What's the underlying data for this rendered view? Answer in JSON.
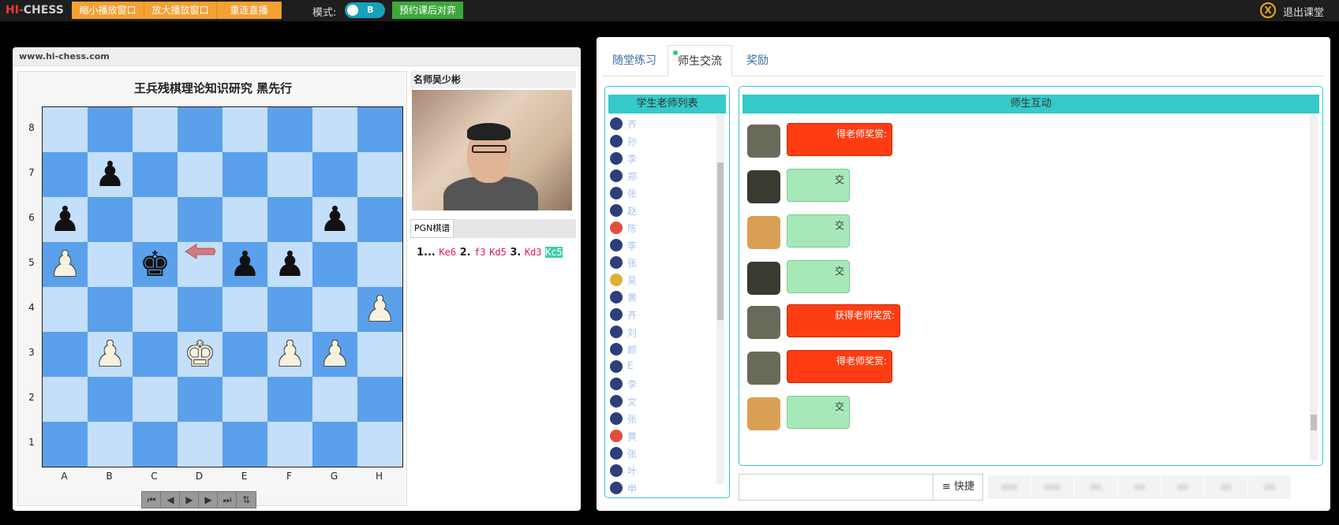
{
  "topbar": {
    "logo_hi": "HI-",
    "logo_chess": "CHESS",
    "buttons": [
      "缩小播放窗口",
      "放大播放窗口",
      "重连直播"
    ],
    "mode_label": "模式:",
    "mode_value": "B",
    "reserve_btn": "预约课后对弈",
    "exit_icon": "X",
    "exit_label": "退出课堂"
  },
  "board_window": {
    "url": "www.hi-chess.com",
    "title": "王兵残棋理论知识研究 黑先行",
    "files": [
      "A",
      "B",
      "C",
      "D",
      "E",
      "F",
      "G",
      "H"
    ],
    "ranks": [
      "8",
      "7",
      "6",
      "5",
      "4",
      "3",
      "2",
      "1"
    ],
    "pieces": [
      {
        "sq": "b7",
        "glyph": "♟",
        "color": "b"
      },
      {
        "sq": "a6",
        "glyph": "♟",
        "color": "b"
      },
      {
        "sq": "g6",
        "glyph": "♟",
        "color": "b"
      },
      {
        "sq": "a5",
        "glyph": "♟",
        "color": "w"
      },
      {
        "sq": "c5",
        "glyph": "♚",
        "color": "b"
      },
      {
        "sq": "e5",
        "glyph": "♟",
        "color": "b"
      },
      {
        "sq": "f5",
        "glyph": "♟",
        "color": "b"
      },
      {
        "sq": "h4",
        "glyph": "♟",
        "color": "w"
      },
      {
        "sq": "b3",
        "glyph": "♟",
        "color": "w"
      },
      {
        "sq": "d3",
        "glyph": "♚",
        "color": "w"
      },
      {
        "sq": "f3",
        "glyph": "♟",
        "color": "w"
      },
      {
        "sq": "g3",
        "glyph": "♟",
        "color": "w"
      }
    ],
    "nav_buttons": [
      "⏮",
      "◀",
      "▶",
      "▶",
      "⏭",
      "⇅"
    ],
    "teacher_title": "名师吴少彬",
    "pgn_tab": "PGN棋谱",
    "pgn": {
      "n1": "1...",
      "m1": "Ke6",
      "n2": "2.",
      "m2a": "f3",
      "m2b": "Kd5",
      "n3": "3.",
      "m3a": "Kd3",
      "m3b": "Kc5"
    }
  },
  "interaction": {
    "tabs": [
      "随堂练习",
      "师生交流",
      "奖励"
    ],
    "active_tab": "师生交流",
    "student_header": "学生老师列表",
    "students": [
      {
        "name": "齐",
        "av": "#2b3f7a"
      },
      {
        "name": "孙",
        "av": "#2b3f7a"
      },
      {
        "name": "李",
        "av": "#2b3f7a"
      },
      {
        "name": "郑",
        "av": "#2b3f7a"
      },
      {
        "name": "张",
        "av": "#2b3f7a"
      },
      {
        "name": "赵",
        "av": "#2b3f7a"
      },
      {
        "name": "陈",
        "av": "#e2503a"
      },
      {
        "name": "李",
        "av": "#2b3f7a"
      },
      {
        "name": "张",
        "av": "#2b3f7a"
      },
      {
        "name": "吴",
        "av": "#e0b034"
      },
      {
        "name": "黄",
        "av": "#2b3f7a"
      },
      {
        "name": "齐",
        "av": "#2b3f7a"
      },
      {
        "name": "刘",
        "av": "#2b3f7a"
      },
      {
        "name": "颜",
        "av": "#2b3f7a"
      },
      {
        "name": "E",
        "av": "#2b3f7a"
      },
      {
        "name": "李",
        "av": "#2b3f7a"
      },
      {
        "name": "文",
        "av": "#2b3f7a"
      },
      {
        "name": "张",
        "av": "#2b3f7a"
      },
      {
        "name": "黄",
        "av": "#e2503a"
      },
      {
        "name": "张",
        "av": "#2b3f7a"
      },
      {
        "name": "叶",
        "av": "#2b3f7a"
      },
      {
        "name": "申",
        "av": "#2b3f7a"
      }
    ],
    "chat_header": "师生互动",
    "messages": [
      {
        "type": "red",
        "text": "得老师奖赏:",
        "av": "#6a6a5a"
      },
      {
        "type": "green",
        "text": "交",
        "av": "#3a3a30"
      },
      {
        "type": "green",
        "text": "交",
        "av": "#d9a055"
      },
      {
        "type": "green",
        "text": "交",
        "av": "#3a3a30"
      },
      {
        "type": "red",
        "text": "获得老师奖赏:",
        "av": "#6a6a5a"
      },
      {
        "type": "red",
        "text": "得老师奖赏:",
        "av": "#6a6a5a"
      },
      {
        "type": "green",
        "text": "交",
        "av": "#d9a055"
      }
    ],
    "quick_label": "≡ 快捷",
    "bottom_buttons": [
      "ooo",
      "ooo",
      "oo",
      "oo",
      "oo",
      "oo",
      "oo"
    ]
  }
}
